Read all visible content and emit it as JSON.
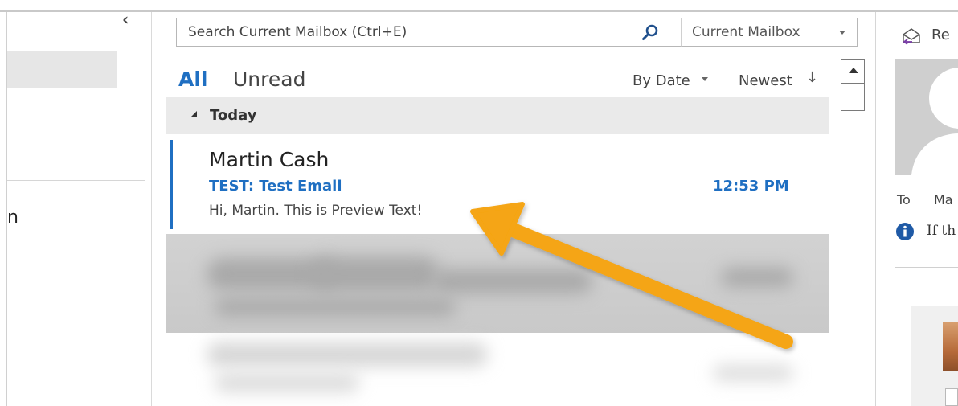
{
  "search": {
    "placeholder": "Search Current Mailbox (Ctrl+E)",
    "scope": "Current Mailbox"
  },
  "filters": {
    "all": "All",
    "unread": "Unread"
  },
  "sort": {
    "by": "By Date",
    "order": "Newest"
  },
  "groups": [
    {
      "label": "Today",
      "items": [
        {
          "sender": "Martin Cash",
          "subject": "TEST: Test Email",
          "time": "12:53 PM",
          "preview": "Hi, Martin. This is Preview Text!"
        }
      ]
    }
  ],
  "reading_pane": {
    "reply_label": "Re",
    "to_label": "To",
    "to_name": "Ma",
    "info_text": "If th"
  },
  "left_pane": {
    "visible_text": "n"
  },
  "colors": {
    "accent": "#1f6fc2",
    "annotation_arrow": "#f5a512",
    "group_header_bg": "#eaeaea"
  },
  "icons": {
    "search": "search-icon",
    "reply": "reply-icon",
    "info": "info-icon",
    "collapse": "chevron-left-icon"
  }
}
